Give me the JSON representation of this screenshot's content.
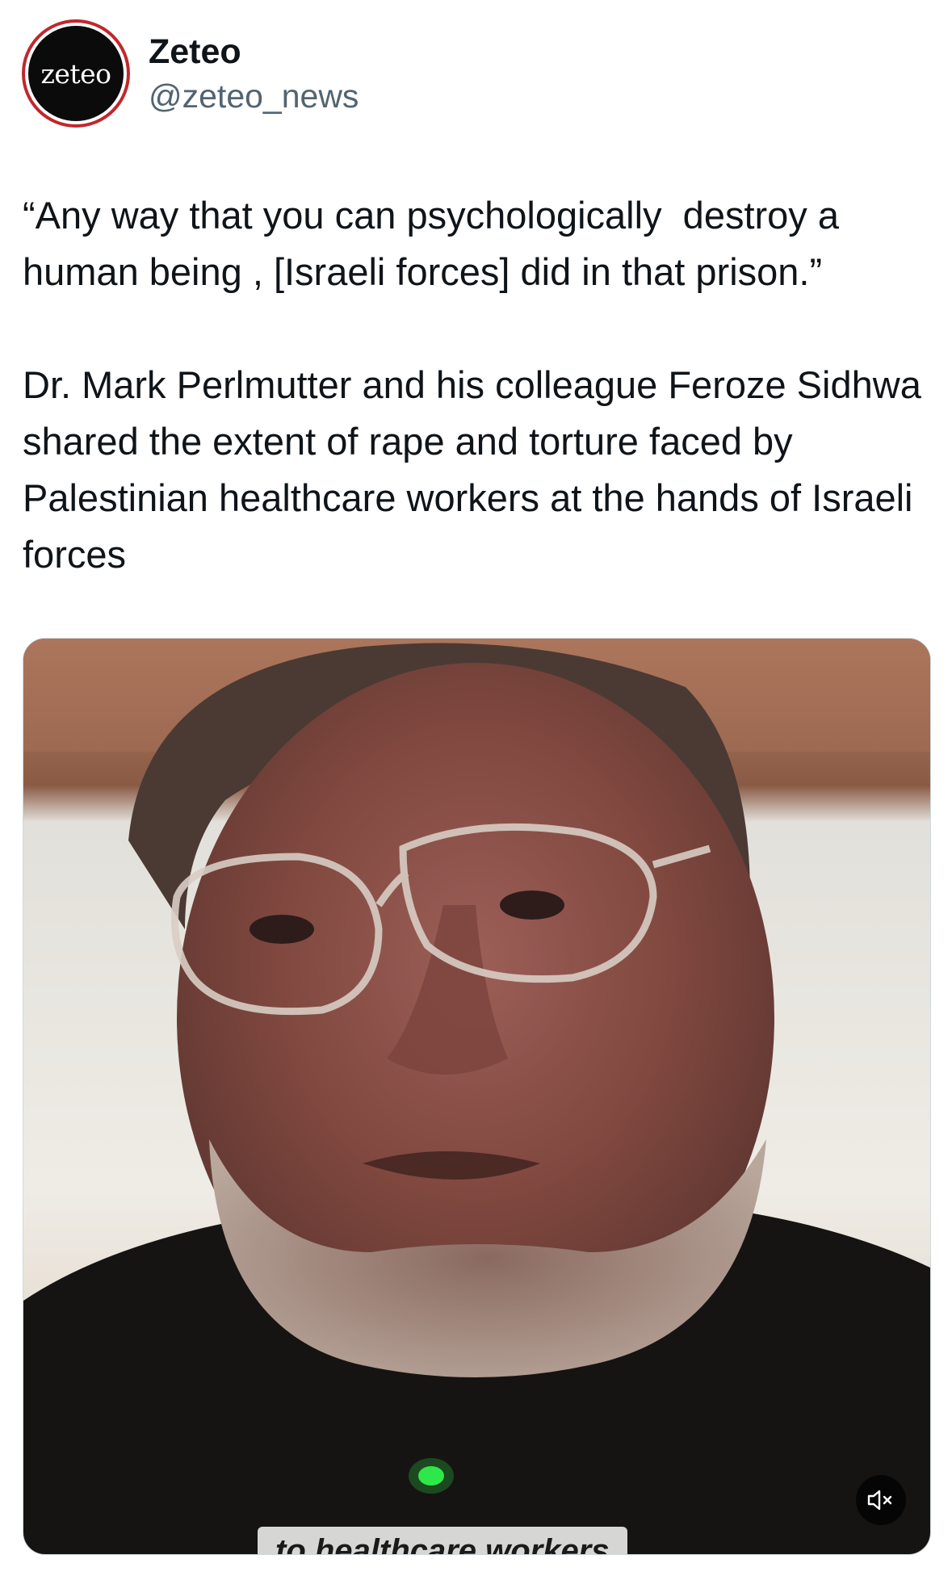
{
  "account": {
    "avatar_text": "zeteo",
    "display_name": "Zeteo",
    "handle": "@zeteo_news"
  },
  "tweet": {
    "paragraphs": [
      "“Any way that you can psychologically  destroy a human being , [Israeli forces] did in that prison.”",
      "Dr. Mark Perlmutter and his colleague Feroze Sidhwa shared the extent of rape and torture faced by Palestinian healthcare workers at the hands of Israeli forces"
    ]
  },
  "media": {
    "type": "video",
    "subject": "man with glasses speaking on video call",
    "caption": "to healthcare workers",
    "muted": true,
    "mute_icon": "speaker-muted-icon"
  },
  "colors": {
    "text_primary": "#0f1419",
    "text_secondary": "#536471",
    "avatar_ring": "#c0282d",
    "avatar_bg": "#0b0b0b"
  }
}
